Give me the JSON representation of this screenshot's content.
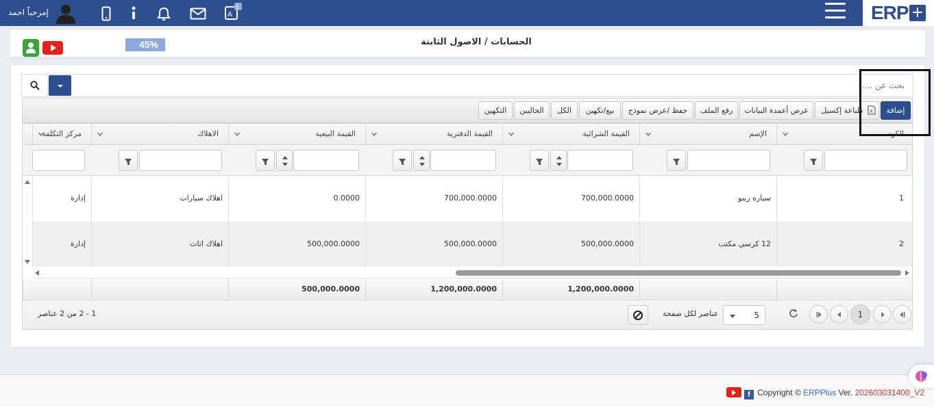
{
  "header": {
    "greeting": "إمرحباً احمد",
    "logo_text": "ERP"
  },
  "page": {
    "title": "الحسابات / الاصول الثابتة",
    "progress": {
      "percent": 45,
      "label": "45%"
    }
  },
  "search": {
    "placeholder": "بحث عن ...."
  },
  "toolbar": {
    "buttons": [
      "إضافة",
      "طباعة إكسيل",
      "عرض أعمدة البيانات",
      "رفع الملف",
      "حفظ /عرض نموذج",
      "بيع/تكهين",
      "الكل",
      "الحاليين",
      "التكهين"
    ]
  },
  "grid": {
    "columns": [
      "الكود",
      "الإسم",
      "القيمة الشرائية",
      "القيمة الدفترية",
      "القيمة البيعية",
      "الاهلاك",
      "مركز التكلفة"
    ],
    "rows": [
      {
        "code": "1",
        "name": "سياره رينو",
        "purchase": "700,000.0000",
        "book": "700,000.0000",
        "sale": "0.0000",
        "depreciation": "اهلاك سيارات",
        "cost_center": "إدارة"
      },
      {
        "code": "2",
        "name": "12 كرسي مكتب",
        "purchase": "500,000.0000",
        "book": "500,000.0000",
        "sale": "500,000.0000",
        "depreciation": "اهلاك اثاث",
        "cost_center": "إدارة"
      }
    ],
    "totals": {
      "purchase": "1,200,000.0000",
      "book": "1,200,000.0000",
      "sale": "500,000.0000"
    }
  },
  "pager": {
    "current_page": "1",
    "page_size": "5",
    "page_size_label": "عناصر لكل صفحة",
    "info": "1 - 2 من 2 عناصر"
  },
  "footer": {
    "copyright": "Copyright ©",
    "brand": "ERPPlus",
    "ver_label": "Ver.",
    "version": "202603031400_V2"
  },
  "colors": {
    "primary": "#2e4f8f",
    "progress": "#8fa8dc",
    "youtube": "#e62117",
    "user_green": "#3fa23f"
  }
}
